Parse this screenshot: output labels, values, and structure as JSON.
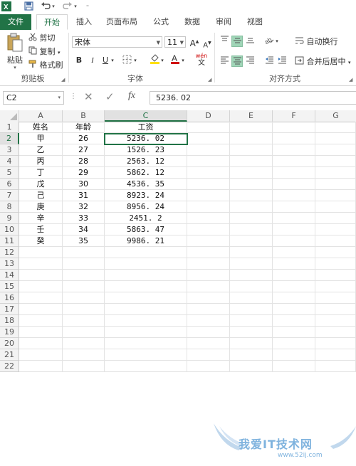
{
  "qat": {
    "undo_icon": "undo-icon",
    "redo_icon": "redo-icon",
    "save_icon": "save-icon"
  },
  "tabs": [
    {
      "label": "文件"
    },
    {
      "label": "开始"
    },
    {
      "label": "插入"
    },
    {
      "label": "页面布局"
    },
    {
      "label": "公式"
    },
    {
      "label": "数据"
    },
    {
      "label": "审阅"
    },
    {
      "label": "视图"
    }
  ],
  "clipboard": {
    "paste_label": "粘贴",
    "cut_label": "剪切",
    "copy_label": "复制",
    "format_painter_label": "格式刷",
    "group_label": "剪贴板"
  },
  "font": {
    "name": "宋体",
    "size": "11",
    "bold": "B",
    "italic": "I",
    "underline": "U",
    "increase": "A",
    "decrease": "A",
    "wen": "wén",
    "wen_char": "文",
    "group_label": "字体",
    "accent_color": "#d00000",
    "highlight_color": "#ffe000"
  },
  "alignment": {
    "wrap_label": "自动换行",
    "merge_label": "合并后居中",
    "group_label": "对齐方式"
  },
  "formula_bar": {
    "name_box": "C2",
    "cancel": "✕",
    "enter": "✓",
    "fx": "fx",
    "formula": "5236. 02"
  },
  "columns": [
    "A",
    "B",
    "C",
    "D",
    "E",
    "F",
    "G"
  ],
  "rows": [
    {
      "n": "1",
      "a": "姓名",
      "b": "年龄",
      "c": "工资"
    },
    {
      "n": "2",
      "a": "甲",
      "b": "26",
      "c": "5236. 02"
    },
    {
      "n": "3",
      "a": "乙",
      "b": "27",
      "c": "1526. 23"
    },
    {
      "n": "4",
      "a": "丙",
      "b": "28",
      "c": "2563. 12"
    },
    {
      "n": "5",
      "a": "丁",
      "b": "29",
      "c": "5862. 12"
    },
    {
      "n": "6",
      "a": "戊",
      "b": "30",
      "c": "4536. 35"
    },
    {
      "n": "7",
      "a": "己",
      "b": "31",
      "c": "8923. 24"
    },
    {
      "n": "8",
      "a": "庚",
      "b": "32",
      "c": "8956. 24"
    },
    {
      "n": "9",
      "a": "辛",
      "b": "33",
      "c": "2451. 2"
    },
    {
      "n": "10",
      "a": "壬",
      "b": "34",
      "c": "5863. 47"
    },
    {
      "n": "11",
      "a": "癸",
      "b": "35",
      "c": "9986. 21"
    },
    {
      "n": "12",
      "a": "",
      "b": "",
      "c": ""
    },
    {
      "n": "13",
      "a": "",
      "b": "",
      "c": ""
    },
    {
      "n": "14",
      "a": "",
      "b": "",
      "c": ""
    },
    {
      "n": "15",
      "a": "",
      "b": "",
      "c": ""
    },
    {
      "n": "16",
      "a": "",
      "b": "",
      "c": ""
    },
    {
      "n": "17",
      "a": "",
      "b": "",
      "c": ""
    },
    {
      "n": "18",
      "a": "",
      "b": "",
      "c": ""
    },
    {
      "n": "19",
      "a": "",
      "b": "",
      "c": ""
    },
    {
      "n": "20",
      "a": "",
      "b": "",
      "c": ""
    },
    {
      "n": "21",
      "a": "",
      "b": "",
      "c": ""
    },
    {
      "n": "22",
      "a": "",
      "b": "",
      "c": ""
    }
  ],
  "watermark": {
    "text": "我爱IT技术网",
    "sub": "www.52ij.com"
  },
  "colors": {
    "brand": "#217346",
    "selected_align": "#9fd5b7"
  }
}
